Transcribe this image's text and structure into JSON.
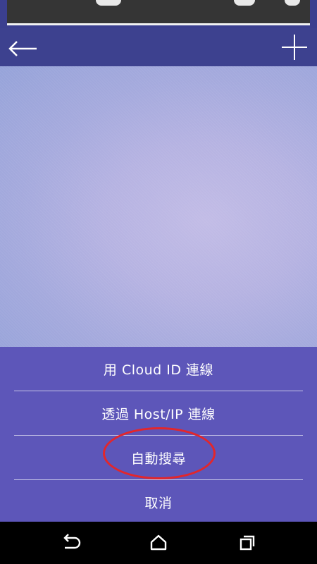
{
  "toolbar": {
    "back_icon": "back-arrow-icon",
    "add_icon": "plus-icon",
    "background_color": "#3d418f"
  },
  "sheet": {
    "background_color": "#5d56b9",
    "items": [
      {
        "label": "用 Cloud ID 連線"
      },
      {
        "label": "透過 Host/IP 連線"
      },
      {
        "label": "自動搜尋",
        "highlighted": true
      },
      {
        "label": "取消"
      }
    ],
    "highlight_color": "#e3262b"
  },
  "navbar": {
    "icons": [
      "back-nav-icon",
      "home-nav-icon",
      "recents-nav-icon"
    ]
  }
}
